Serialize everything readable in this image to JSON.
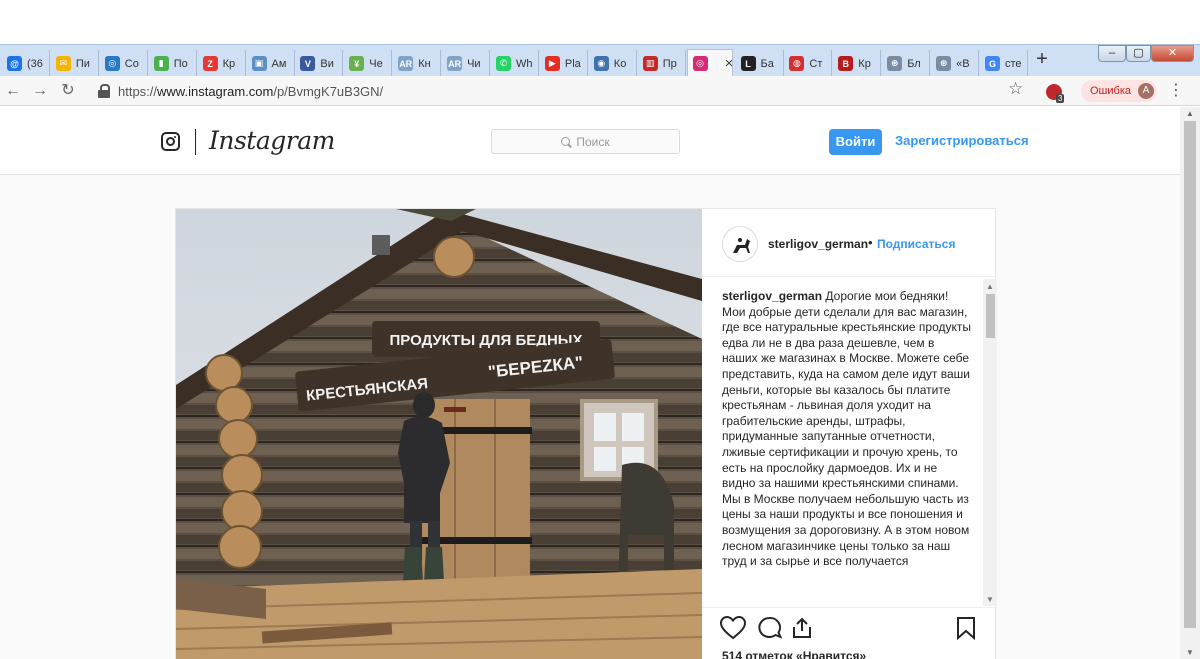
{
  "browser": {
    "tabs": [
      {
        "label": "(36",
        "color": "#1a73e8",
        "glyph": "@"
      },
      {
        "label": "Пи",
        "color": "#f4b400",
        "glyph": "✉"
      },
      {
        "label": "Co",
        "color": "#2b79c2",
        "glyph": "◎"
      },
      {
        "label": "По",
        "color": "#4caf50",
        "glyph": "▮"
      },
      {
        "label": "Кр",
        "color": "#e53935",
        "glyph": "Z"
      },
      {
        "label": "Ам",
        "color": "#5c8fc4",
        "glyph": "▣"
      },
      {
        "label": "Ви",
        "color": "#3a5a9b",
        "glyph": "V"
      },
      {
        "label": "Че",
        "color": "#6ab04c",
        "glyph": "¥"
      },
      {
        "label": "Кн",
        "color": "#7fa3c8",
        "glyph": "AR"
      },
      {
        "label": "Чи",
        "color": "#7fa3c8",
        "glyph": "AR"
      },
      {
        "label": "Wh",
        "color": "#25d366",
        "glyph": "✆"
      },
      {
        "label": "Pla",
        "color": "#e52d27",
        "glyph": "▶"
      },
      {
        "label": "Ко",
        "color": "#3f72af",
        "glyph": "◉"
      },
      {
        "label": "Пр",
        "color": "#c62828",
        "glyph": "▥"
      },
      {
        "label": "",
        "color": "#d62976",
        "glyph": "◎",
        "active": true
      },
      {
        "label": "Ба",
        "color": "#222222",
        "glyph": "L"
      },
      {
        "label": "Ст",
        "color": "#d32f2f",
        "glyph": "◍"
      },
      {
        "label": "Кр",
        "color": "#b71c1c",
        "glyph": "B"
      },
      {
        "label": "Бл",
        "color": "#7a8ca3",
        "glyph": "⊛"
      },
      {
        "label": "«В",
        "color": "#7a8ca3",
        "glyph": "⊛"
      },
      {
        "label": "сте",
        "color": "#4285f4",
        "glyph": "G"
      }
    ],
    "active_tab_close": "×",
    "new_tab": "+",
    "url_scheme": "https://",
    "url_host": "www.instagram.com",
    "url_path": "/p/BvmgK7uB3GN/",
    "extension_badge": "3",
    "error_label": "Ошибка",
    "profile_initial": "A",
    "win_min": "–",
    "win_max": "▢",
    "win_close": "✕"
  },
  "instagram": {
    "wordmark": "Instagram",
    "search_placeholder": "Поиск",
    "login_label": "Войти",
    "signup_label": "Зарегистрироваться"
  },
  "post": {
    "username": "sterligov_german",
    "separator": "•",
    "follow_label": "Подписаться",
    "caption_user": "sterligov_german",
    "caption_text": "Дорогие мои бедняки! Мои добрые дети сделали для вас магазин, где все натуральные крестьянские продукты едва ли не в два раза дешевле, чем в наших же магазинах в Москве. Можете себе представить, куда на самом деле идут ваши деньги, которые вы казалось бы платите крестьянам - львиная доля уходит на грабительские аренды, штрафы, придуманные запутанные отчетности, лживые сертификации и прочую хрень, то есть на прослойку дармоедов. Их и не видно за нашими крестьянскими спинами. Мы в Москве получаем небольшую часть из цены за наши продукты и все поношения и возмущения за дороговизну. А в этом новом лесном магазинчике цены только за наш труд и за сырье и все получается",
    "sign_line1": "ПРОДУКТЫ ДЛЯ БЕДНЫХ",
    "sign_line2": "КРЕСТЬЯНСКАЯ",
    "sign_line3": "\"БЕРЕZКА\"",
    "likes_peek": "514 отметок «Нравится»"
  }
}
